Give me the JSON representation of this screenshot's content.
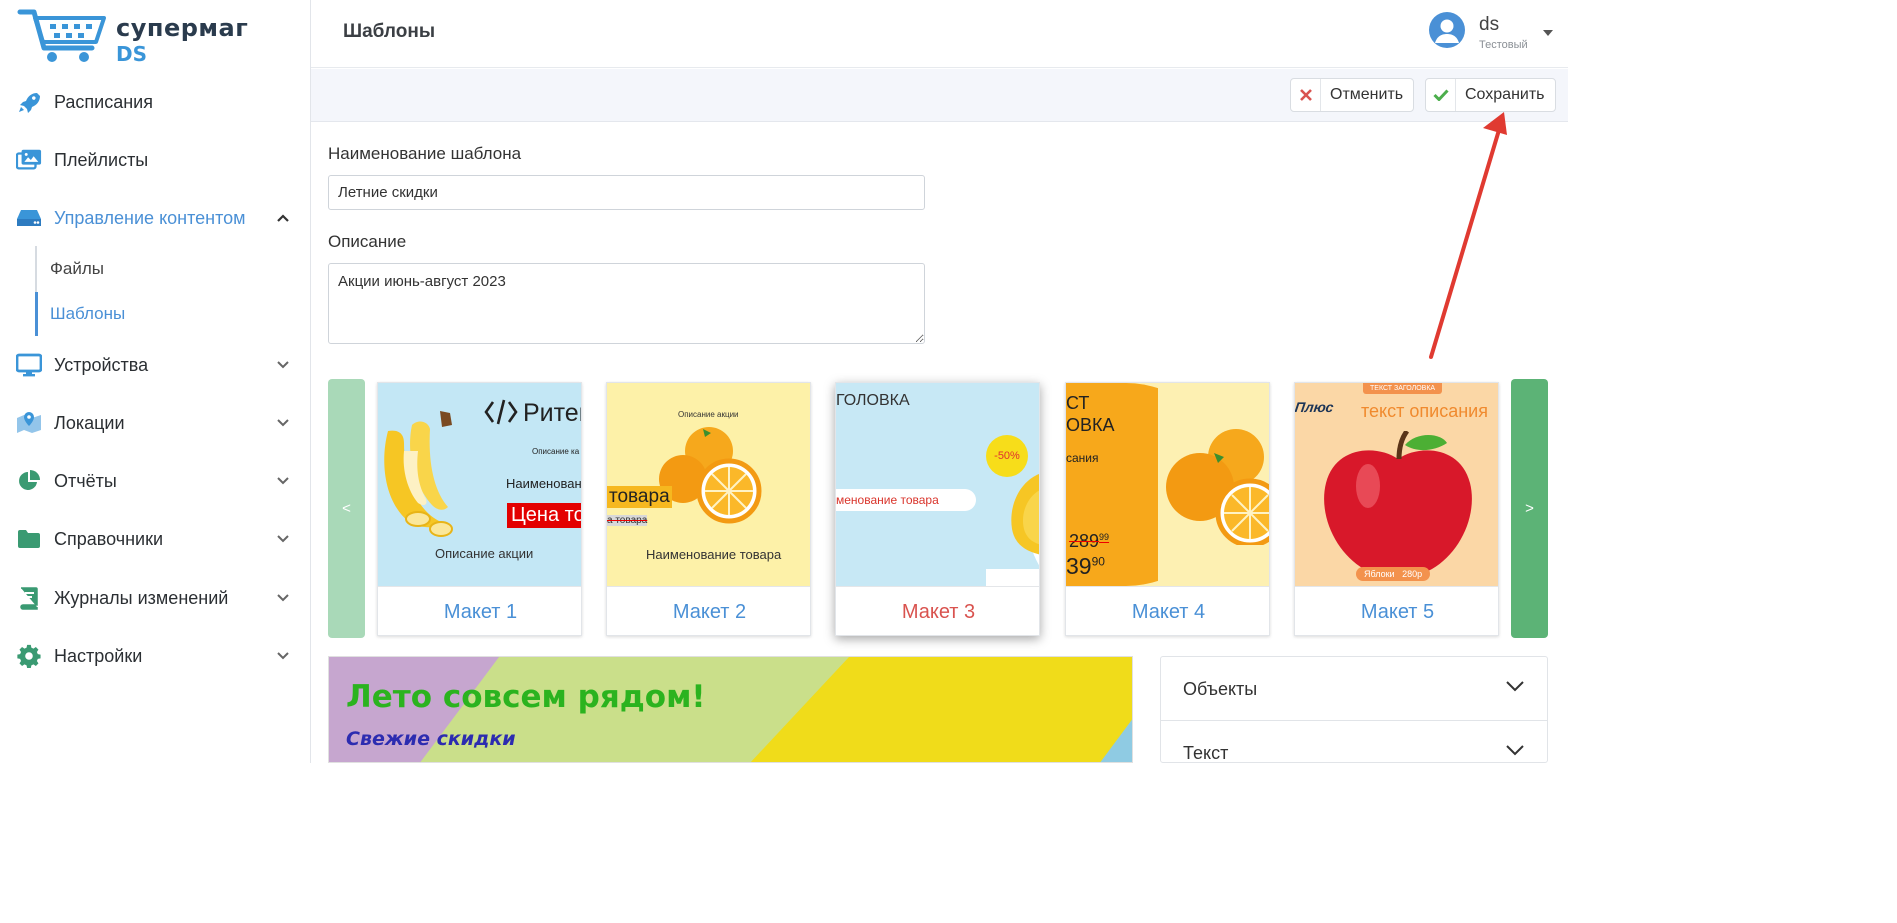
{
  "brand": {
    "name_line1": "супермаг",
    "name_line2": "DS"
  },
  "sidebar": {
    "items": [
      {
        "label": "Расписания",
        "icon": "rocket-icon"
      },
      {
        "label": "Плейлисты",
        "icon": "images-icon"
      },
      {
        "label": "Управление контентом",
        "icon": "storage-icon",
        "expanded": true
      },
      {
        "label": "Устройства",
        "icon": "monitor-icon"
      },
      {
        "label": "Локации",
        "icon": "map-pin-icon"
      },
      {
        "label": "Отчёты",
        "icon": "pie-chart-icon"
      },
      {
        "label": "Справочники",
        "icon": "folder-icon"
      },
      {
        "label": "Журналы изменений",
        "icon": "book-icon"
      },
      {
        "label": "Настройки",
        "icon": "gear-icon"
      }
    ],
    "subitems": [
      {
        "label": "Файлы",
        "active": false
      },
      {
        "label": "Шаблоны",
        "active": true
      }
    ]
  },
  "header": {
    "title": "Шаблоны",
    "user": {
      "name": "ds",
      "role": "Тестовый"
    }
  },
  "toolbar": {
    "cancel_label": "Отменить",
    "save_label": "Сохранить"
  },
  "form": {
    "name_label": "Наименование шаблона",
    "name_value": "Летние скидки",
    "desc_label": "Описание",
    "desc_value": "Акции июнь-август 2023"
  },
  "carousel": {
    "prev_label": "<",
    "next_label": ">",
    "selected_index": 2,
    "cards": [
      {
        "title": "Макет 1",
        "thumb": {
          "headline": "Ритей",
          "line1": "Описание ка",
          "line2": "Наименовани",
          "price": "Цена то",
          "footer": "Описание акции"
        }
      },
      {
        "title": "Макет 2",
        "thumb": {
          "top": "Описание акции",
          "price": "товара",
          "old": "а товара",
          "footer": "Наименование товара"
        }
      },
      {
        "title": "Макет 3",
        "thumb": {
          "heading": "ГОЛОВКА",
          "badge": "-50%",
          "name": "менование товара"
        }
      },
      {
        "title": "Макет 4",
        "thumb": {
          "t1": "СТ",
          "t2": "ОВКА",
          "t3": "сания",
          "old_price": "289",
          "old_cents": "99",
          "price": "39",
          "cents": "90"
        }
      },
      {
        "title": "Макет 5",
        "thumb": {
          "top_label": "ТЕКСТ ЗАГОЛОВКА",
          "logo": "Плюс",
          "desc": "текст описания",
          "tag_name": "Яблоки",
          "tag_price": "280р"
        }
      }
    ]
  },
  "preview": {
    "title": "Лето совсем рядом!",
    "subtitle": "Свежие скидки"
  },
  "panel": {
    "sections": [
      "Объекты",
      "Текст"
    ]
  },
  "colors": {
    "accent": "#4a90d6",
    "selected": "#d9534f",
    "green": "#5cb376",
    "danger": "#d9534f"
  }
}
